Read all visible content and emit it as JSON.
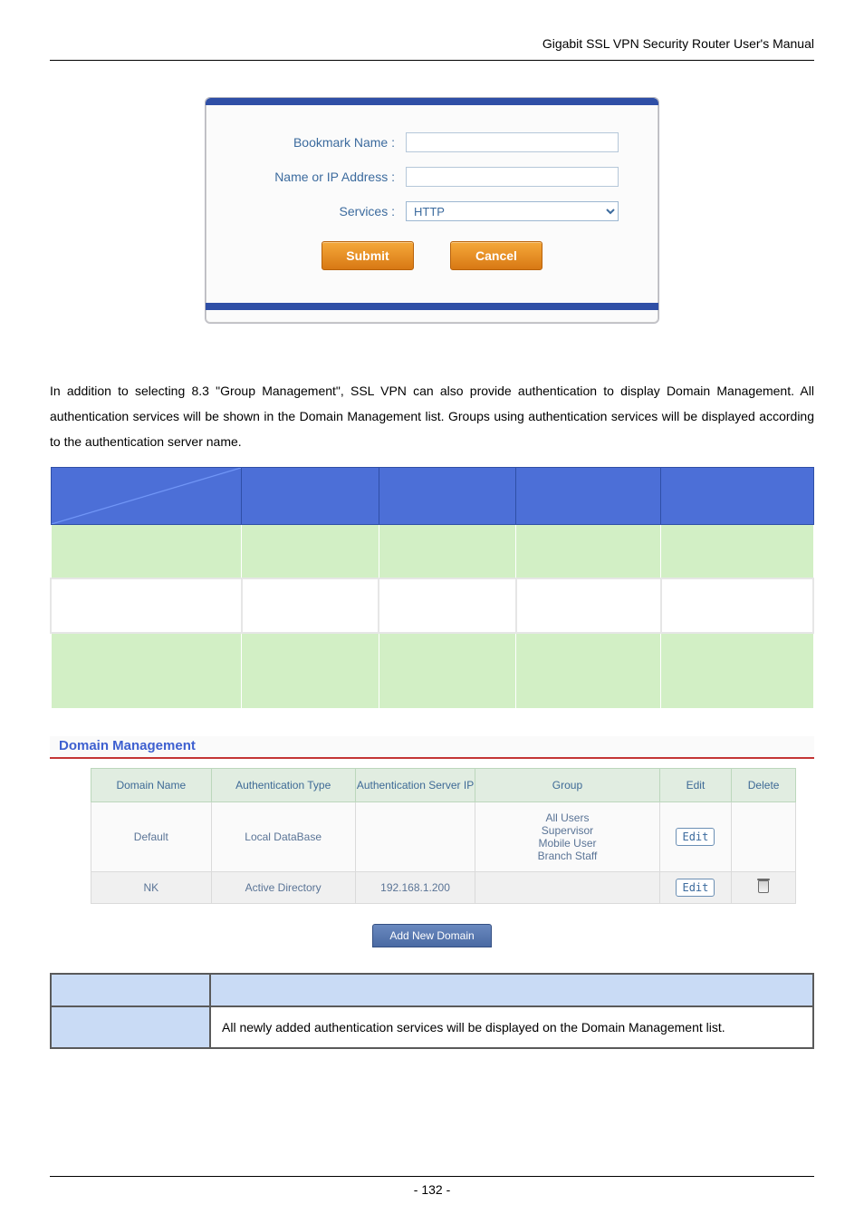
{
  "header": {
    "title": "Gigabit SSL VPN Security Router User's Manual"
  },
  "form": {
    "bookmark_label": "Bookmark Name :",
    "name_ip_label": "Name or IP Address :",
    "services_label": "Services :",
    "services_value": "HTTP",
    "submit_label": "Submit",
    "cancel_label": "Cancel"
  },
  "paragraph": {
    "text": " In addition to selecting 8.3 \"Group Management\", SSL VPN can also provide authentication to display Domain Management. All authentication services will be shown in the Domain Management list. Groups using authentication services will be displayed according to the authentication server name."
  },
  "section_title": "Domain Management",
  "domain_table": {
    "headers": {
      "domain_name": "Domain Name",
      "auth_type": "Authentication Type",
      "auth_server": "Authentication Server IP",
      "group": "Group",
      "edit": "Edit",
      "delete": "Delete"
    },
    "rows": [
      {
        "domain_name": "Default",
        "auth_type": "Local DataBase",
        "auth_server": "",
        "group": "All Users\nSupervisor\nMobile User\nBranch Staff",
        "edit": "Edit",
        "has_delete": false
      },
      {
        "domain_name": "NK",
        "auth_type": "Active Directory",
        "auth_server": "192.168.1.200",
        "group": "",
        "edit": "Edit",
        "has_delete": true
      }
    ]
  },
  "add_domain_label": "Add New Domain",
  "explain": {
    "row1_label": "",
    "row1_text": "All newly added authentication services will be displayed on the Domain Management list."
  },
  "footer": {
    "page_number": "- 132 -"
  }
}
